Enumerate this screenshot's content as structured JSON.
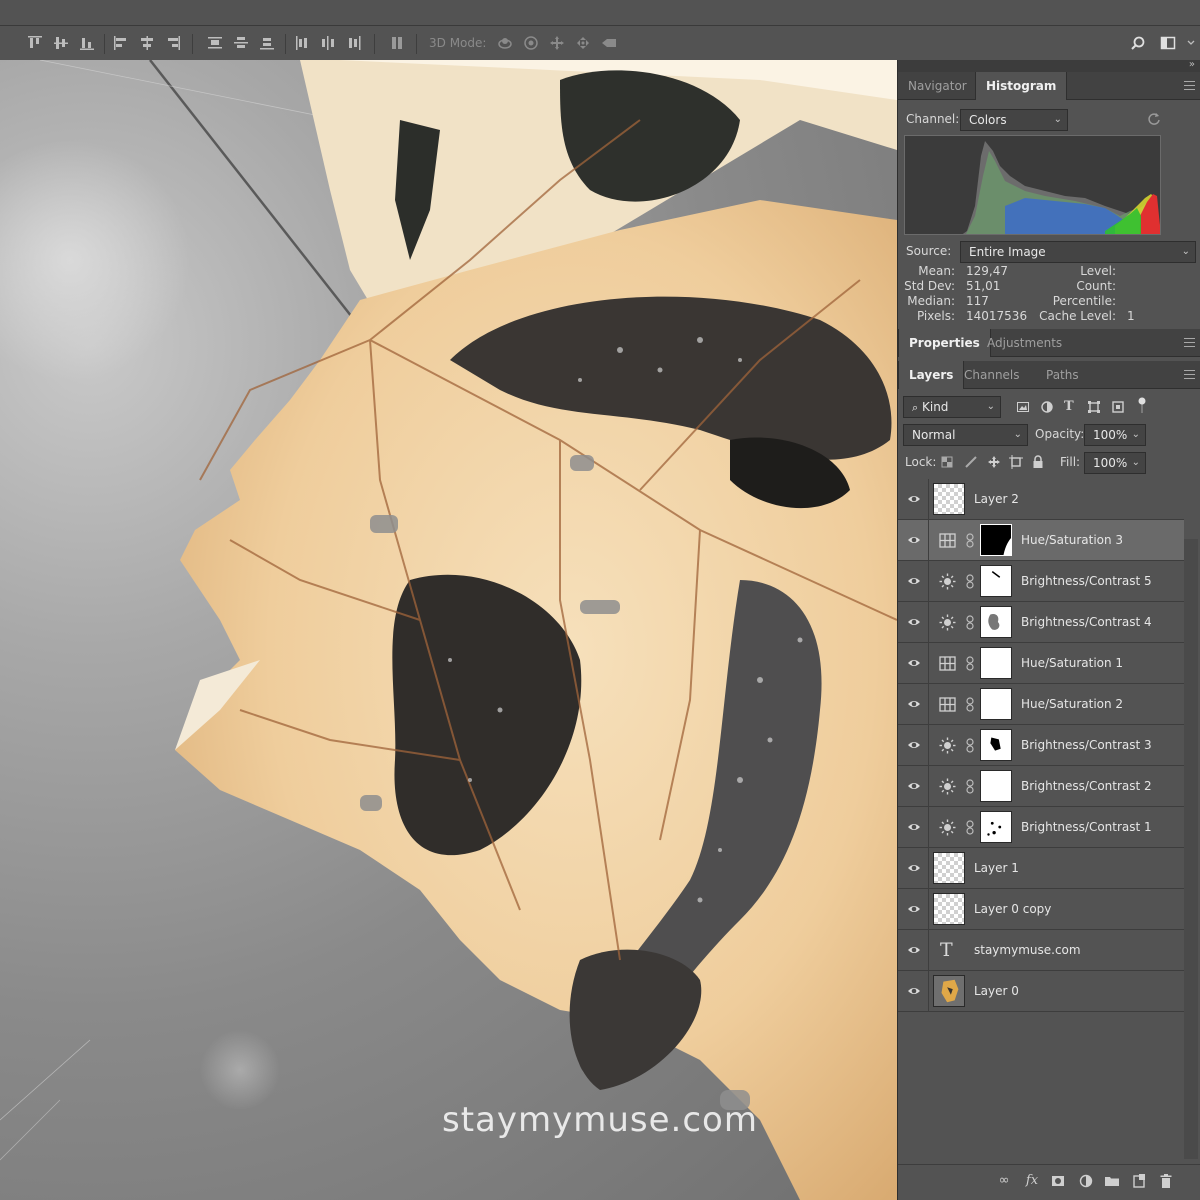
{
  "options_bar": {
    "mode3d_label": "3D Mode:"
  },
  "canvas": {
    "watermark": "staymymuse.com"
  },
  "histogram_panel": {
    "tabs": [
      "Navigator",
      "Histogram"
    ],
    "active_tab": "Histogram",
    "channel_label": "Channel:",
    "channel_value": "Colors",
    "source_label": "Source:",
    "source_value": "Entire Image",
    "stats": {
      "mean_label": "Mean:",
      "mean": "129,47",
      "std_label": "Std Dev:",
      "std": "51,01",
      "median_label": "Median:",
      "median": "117",
      "pixels_label": "Pixels:",
      "pixels": "14017536",
      "level_label": "Level:",
      "level": "",
      "count_label": "Count:",
      "count": "",
      "percentile_label": "Percentile:",
      "percentile": "",
      "cache_label": "Cache Level:",
      "cache": "1"
    }
  },
  "properties_panel": {
    "tabs": [
      "Properties",
      "Adjustments"
    ],
    "active_tab": "Properties"
  },
  "layers_panel": {
    "tabs": [
      "Layers",
      "Channels",
      "Paths"
    ],
    "active_tab": "Layers",
    "filter_kind": "Kind",
    "blend_mode": "Normal",
    "opacity_label": "Opacity:",
    "opacity": "100%",
    "lock_label": "Lock:",
    "fill_label": "Fill:",
    "fill": "100%",
    "layers": [
      {
        "name": "Layer 2",
        "type": "pixel",
        "thumb": "checker",
        "selected": false
      },
      {
        "name": "Hue/Saturation 3",
        "type": "hue",
        "thumb": "mask-black-curve",
        "selected": true
      },
      {
        "name": "Brightness/Contrast 5",
        "type": "brightness",
        "thumb": "mask-line",
        "selected": false
      },
      {
        "name": "Brightness/Contrast 4",
        "type": "brightness",
        "thumb": "mask-blob",
        "selected": false
      },
      {
        "name": "Hue/Saturation 1",
        "type": "hue",
        "thumb": "mask-white",
        "selected": false
      },
      {
        "name": "Hue/Saturation 2",
        "type": "hue",
        "thumb": "mask-white",
        "selected": false
      },
      {
        "name": "Brightness/Contrast 3",
        "type": "brightness",
        "thumb": "mask-shape",
        "selected": false
      },
      {
        "name": "Brightness/Contrast 2",
        "type": "brightness",
        "thumb": "mask-white",
        "selected": false
      },
      {
        "name": "Brightness/Contrast 1",
        "type": "brightness",
        "thumb": "mask-dots",
        "selected": false
      },
      {
        "name": "Layer 1",
        "type": "pixel",
        "thumb": "checker",
        "selected": false
      },
      {
        "name": "Layer 0 copy",
        "type": "pixel",
        "thumb": "checker",
        "selected": false
      },
      {
        "name": "staymymuse.com",
        "type": "text",
        "thumb": "none",
        "selected": false
      },
      {
        "name": "Layer 0",
        "type": "pixel",
        "thumb": "photo",
        "selected": false
      }
    ]
  },
  "colors": {
    "panel_bg": "#535353",
    "selected_row": "#6a6a6a",
    "leaf": "#f0d2a4"
  }
}
